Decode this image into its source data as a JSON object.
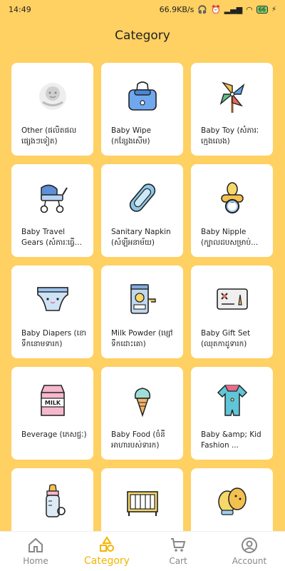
{
  "status": {
    "time": "14:49",
    "speed": "66.9KB/s",
    "battery": "66"
  },
  "header": {
    "title": "Category"
  },
  "categories": [
    {
      "label": "Other (ផលិតផលផ្សេងៗទៀត)",
      "icon": "other-icon"
    },
    {
      "label": "Baby Wipe (កន្សែងសើម)",
      "icon": "baby-wipe-icon"
    },
    {
      "label": "Baby Toy (សំភារៈក្មេងលេង)",
      "icon": "pinwheel-icon"
    },
    {
      "label": "Baby Travel Gears (សំភារៈធ្វើ...",
      "icon": "stroller-icon"
    },
    {
      "label": "Sanitary Napkin (សំឡីអនាម័យ)",
      "icon": "sanitary-pad-icon"
    },
    {
      "label": "Baby Nipple (ក្បាលដបសម្រាប់...",
      "icon": "pacifier-icon"
    },
    {
      "label": "Baby Diapers (ខោទឹកនោមទារក)",
      "icon": "diaper-icon"
    },
    {
      "label": "Milk Powder (ម្សៅទឹកដោះគោ)",
      "icon": "milk-powder-icon"
    },
    {
      "label": "Baby Gift Set (ឈុតកាដូទារក)",
      "icon": "gift-card-icon"
    },
    {
      "label": "Beverage (ភេសជ្ជៈ)",
      "icon": "milk-carton-icon"
    },
    {
      "label": "Baby Food (ចំនីអាហារបស់ទារក)",
      "icon": "ice-cream-icon"
    },
    {
      "label": "Baby &amp; Kid Fashion ...",
      "icon": "romper-icon"
    },
    {
      "label": "",
      "icon": "baby-bottle-icon"
    },
    {
      "label": "",
      "icon": "crib-icon"
    },
    {
      "label": "",
      "icon": "mittens-icon"
    }
  ],
  "nav": {
    "home": "Home",
    "category": "Category",
    "cart": "Cart",
    "account": "Account"
  },
  "colors": {
    "background": "#FFD062",
    "accent": "#F5B400",
    "card": "#FFFFFF"
  }
}
